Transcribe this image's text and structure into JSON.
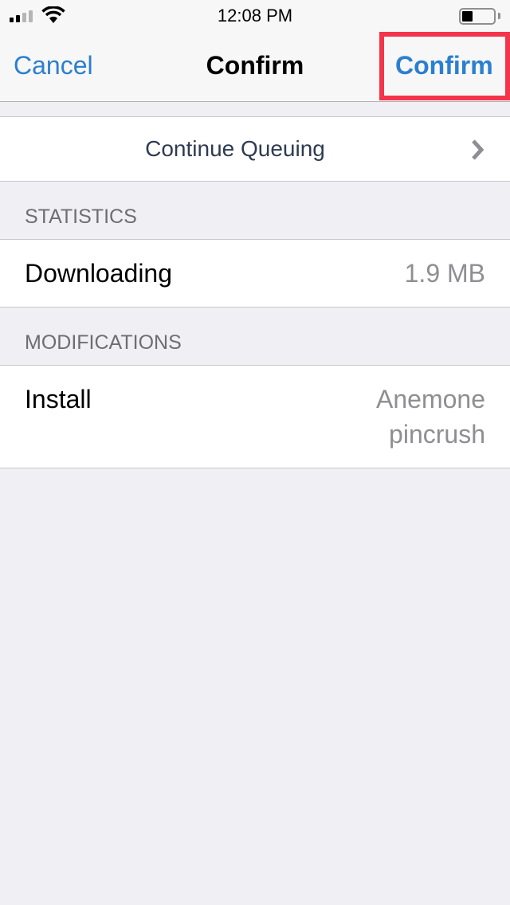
{
  "status_bar": {
    "time": "12:08 PM",
    "signal_bars_active": 2,
    "signal_bars_total": 4,
    "battery_level": 0.3
  },
  "nav": {
    "cancel_label": "Cancel",
    "title": "Confirm",
    "confirm_label": "Confirm",
    "highlight_color": "#f4344a",
    "tint_color": "#2b7fcf"
  },
  "queue": {
    "label": "Continue Queuing"
  },
  "sections": {
    "statistics": {
      "header": "STATISTICS",
      "rows": [
        {
          "label": "Downloading",
          "value": "1.9 MB"
        }
      ]
    },
    "modifications": {
      "header": "MODIFICATIONS",
      "rows": [
        {
          "label": "Install",
          "value": "Anemone pincrush"
        }
      ]
    }
  }
}
